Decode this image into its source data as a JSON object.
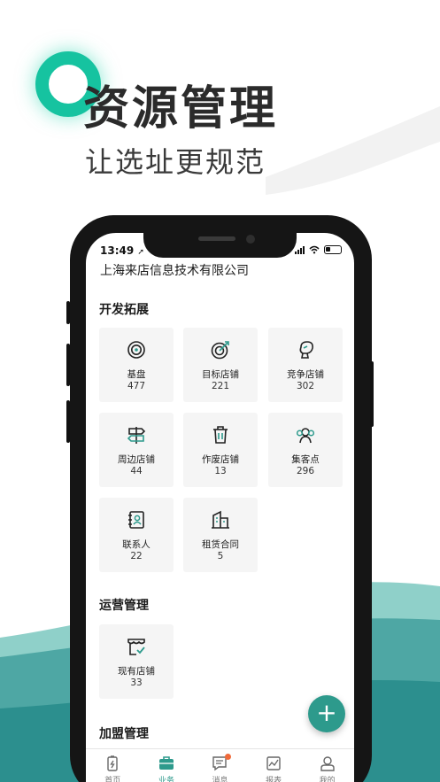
{
  "hero": {
    "title": "资源管理",
    "subtitle": "让选址更规范"
  },
  "status": {
    "time": "13:49",
    "location_arrow": "➚"
  },
  "company": "上海来店信息技术有限公司",
  "sections": {
    "expand": {
      "title": "开发拓展",
      "items": [
        {
          "label": "基盘",
          "count": "477",
          "icon": "target-icon"
        },
        {
          "label": "目标店铺",
          "count": "221",
          "icon": "dart-target-icon"
        },
        {
          "label": "竞争店铺",
          "count": "302",
          "icon": "boxing-glove-icon"
        },
        {
          "label": "周边店铺",
          "count": "44",
          "icon": "signpost-icon"
        },
        {
          "label": "作废店铺",
          "count": "13",
          "icon": "trash-icon"
        },
        {
          "label": "集客点",
          "count": "296",
          "icon": "people-group-icon"
        },
        {
          "label": "联系人",
          "count": "22",
          "icon": "contact-book-icon"
        },
        {
          "label": "租赁合同",
          "count": "5",
          "icon": "building-icon"
        }
      ]
    },
    "operation": {
      "title": "运营管理",
      "items": [
        {
          "label": "现有店铺",
          "count": "33",
          "icon": "store-check-icon"
        }
      ]
    },
    "franchise": {
      "title": "加盟管理"
    }
  },
  "fab": {
    "label": "+"
  },
  "tabs": [
    {
      "label": "首页",
      "icon": "home-icon",
      "active": false
    },
    {
      "label": "业务",
      "icon": "briefcase-icon",
      "active": true
    },
    {
      "label": "消息",
      "icon": "message-icon",
      "active": false
    },
    {
      "label": "报表",
      "icon": "chart-icon",
      "active": false
    },
    {
      "label": "我的",
      "icon": "user-icon",
      "active": false
    }
  ],
  "colors": {
    "accent": "#2d9a8c",
    "hero_ring": "#16c3a0",
    "swoosh": "#3a9a98",
    "badge": "#f06a3a"
  }
}
